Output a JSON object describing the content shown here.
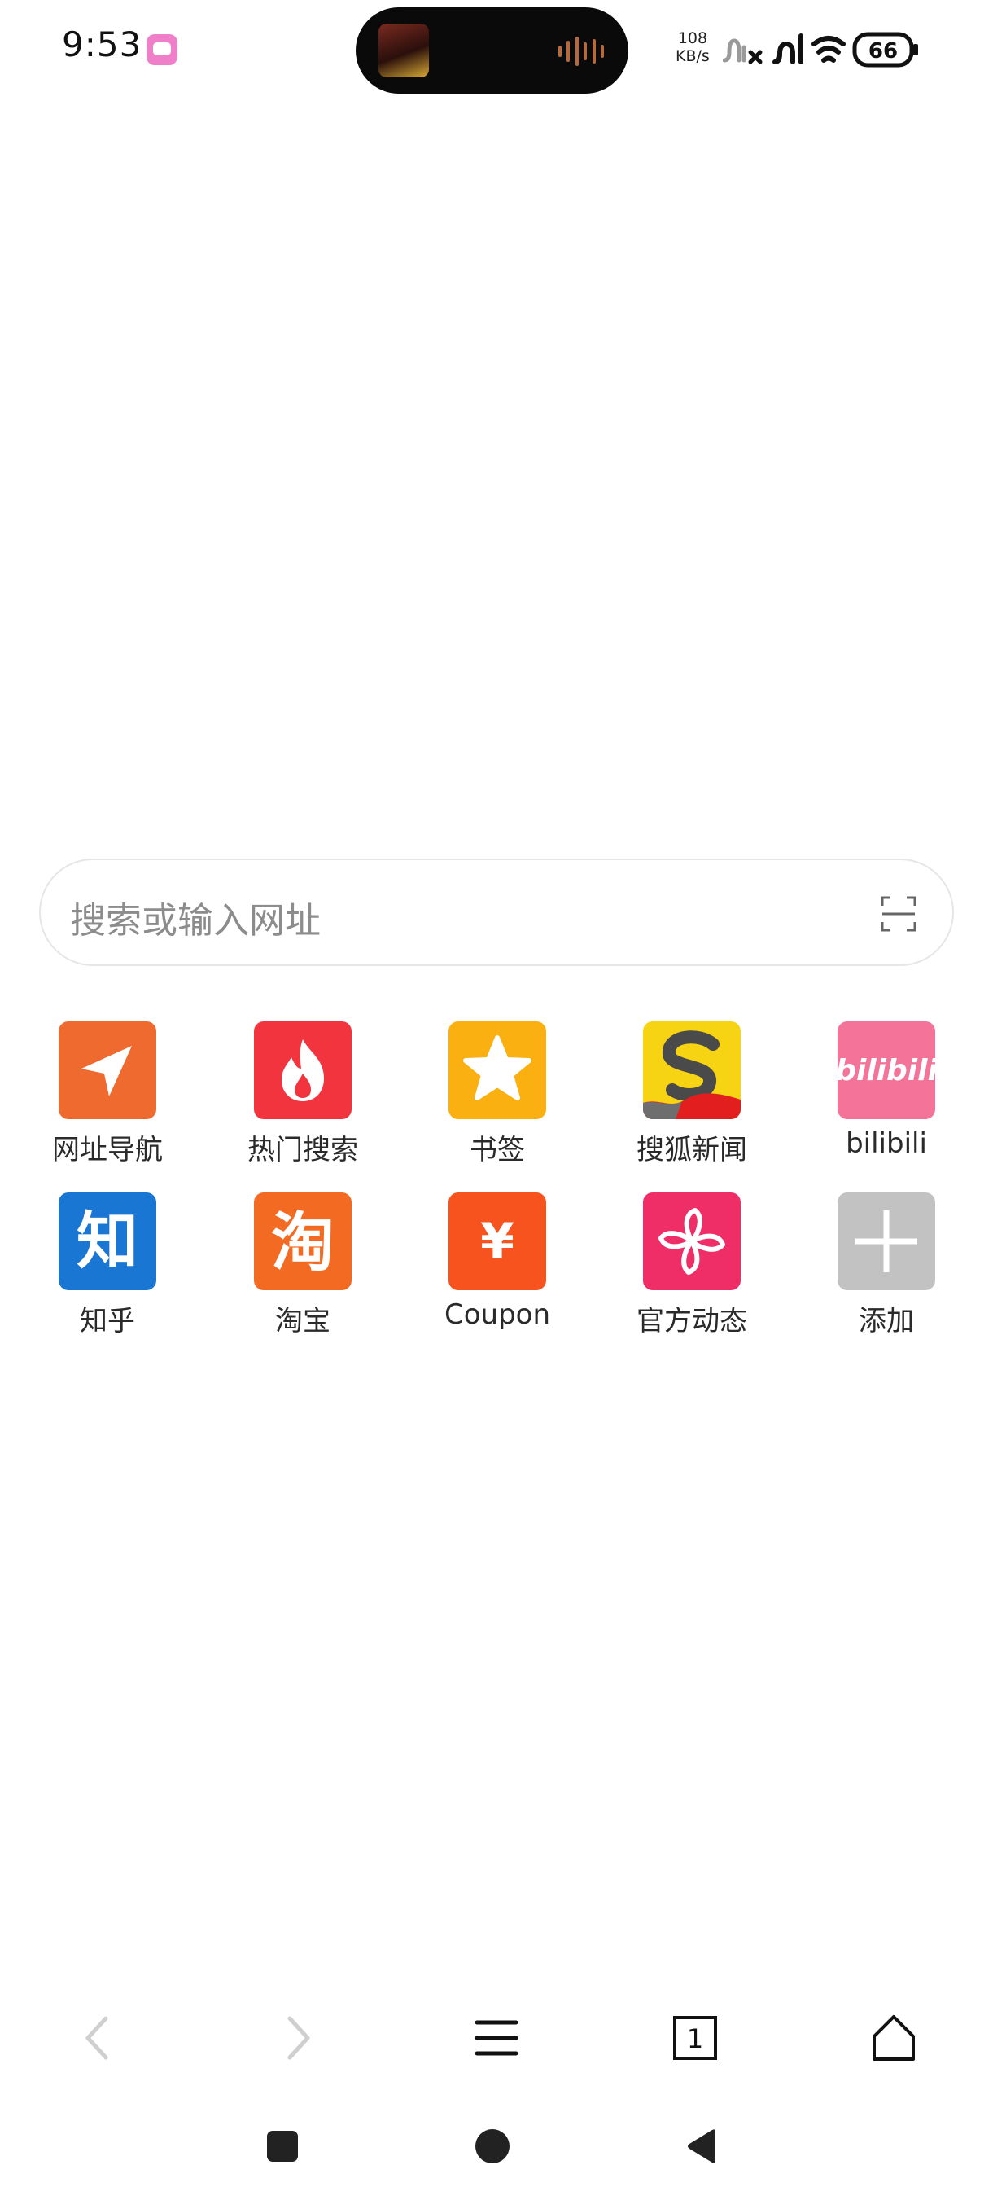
{
  "status_bar": {
    "time": "9:53",
    "net_speed_value": "108",
    "net_speed_unit": "KB/s",
    "battery": "66"
  },
  "search": {
    "placeholder": "搜索或输入网址"
  },
  "shortcuts": [
    {
      "label": "网址导航",
      "icon": "navigation-arrow-icon",
      "color": "#ee6a2f"
    },
    {
      "label": "热门搜索",
      "icon": "flame-icon",
      "color": "#f2343f"
    },
    {
      "label": "书签",
      "icon": "star-icon",
      "color": "#fbb012"
    },
    {
      "label": "搜狐新闻",
      "icon": "sohu-logo-icon",
      "color": "#f6d313"
    },
    {
      "label": "bilibili",
      "icon": "bilibili-logo-icon",
      "color": "#f37399",
      "logo_text": "bilibili"
    },
    {
      "label": "知乎",
      "icon": "zhihu-logo-icon",
      "color": "#1a76d3",
      "logo_text": "知"
    },
    {
      "label": "淘宝",
      "icon": "taobao-logo-icon",
      "color": "#f36b22",
      "logo_text": "淘"
    },
    {
      "label": "Coupon",
      "icon": "yuan-icon",
      "color": "#f6531f",
      "logo_text": "¥"
    },
    {
      "label": "官方动态",
      "icon": "pinwheel-icon",
      "color": "#ef2e68"
    },
    {
      "label": "添加",
      "icon": "plus-icon",
      "color": "#c2c2c2"
    }
  ],
  "toolbar": {
    "tab_count": "1"
  }
}
